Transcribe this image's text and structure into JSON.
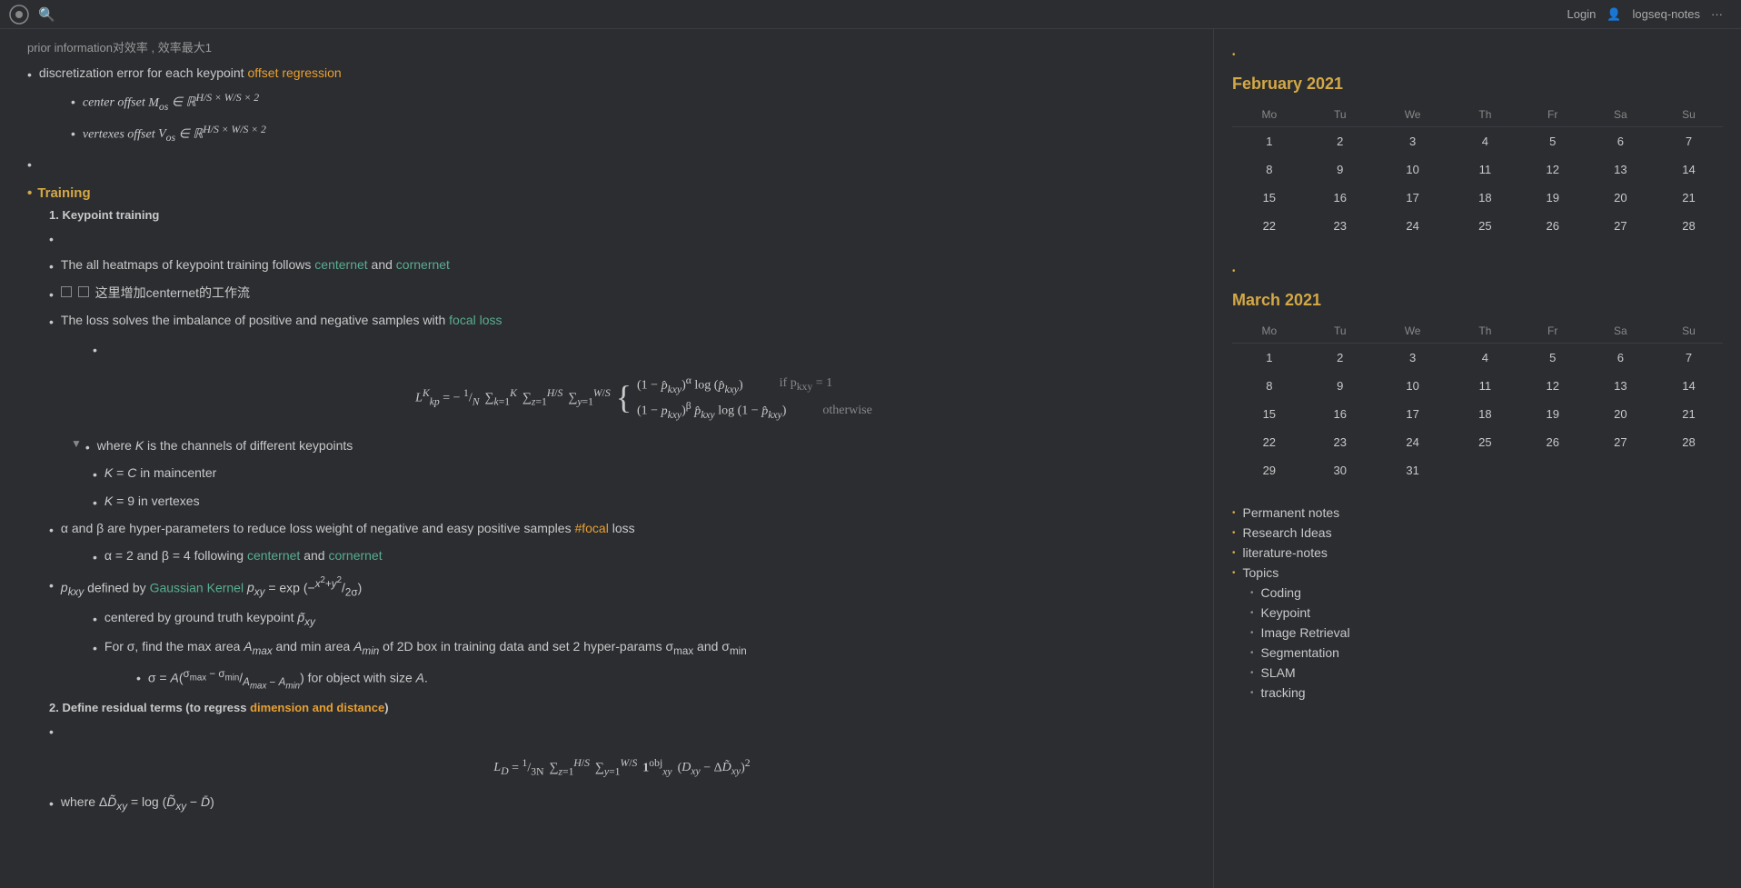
{
  "topbar": {
    "login_label": "Login",
    "notes_label": "logseq-notes",
    "more_label": "···"
  },
  "main_content": {
    "prior_info_text": "prior information对效率 ,效率最大1",
    "discretization_text": "discretization error for each keypoint",
    "offset_regression_label": "offset regression",
    "center_offset_text": "center offset",
    "vertexes_offset_text": "vertexes offset",
    "training_label": "Training",
    "keypoint_training_label": "1. Keypoint training",
    "heatmaps_text": "The all heatmaps of keypoint training follows",
    "centernet_label": "centernet",
    "and_text": "and",
    "cornernet_label": "cornernet",
    "chinese_note_text": "这里增加centernet的工作流",
    "loss_text": "The loss solves the imbalance of positive and negative samples with",
    "focal_loss_label": "focal loss",
    "where_K_text": "where K is the channels of different keypoints",
    "K_equals_C_text": "K = C in maincenter",
    "K_equals_9_text": "K = 9 in vertexes",
    "alpha_beta_text": "α and β are hyper-parameters to reduce loss weight of negative and easy positive samples #focal loss",
    "alpha_beta_values_text": "α = 2 and β = 4 following centernet and cornernet",
    "pkxy_text": "p_kxy defined by Gaussian Kernel",
    "centered_text": "centered by ground truth keypoint p̃_xy",
    "sigma_text": "For σ, find the max area A_max and min area A_min of 2D box in training data and set 2 hyper-params σ_max and σ_min",
    "sigma_formula_text": "σ = A((σ_max - σ_min)/(A_max - A_min)) for object with size A.",
    "define_residual_label": "2. Define residual terms (to regress",
    "dimension_distance_label": "dimension and distance",
    "define_residual_end": ")",
    "where_delta_text": "where Δ D̃_xy = log (D̃_xy - D̄)",
    "formula_lkp_parts": {
      "main": "L^K_kp = -1/N Σ Σ Σ {",
      "case1_expr": "(1 - p̂_kxy)^α log(p̂_kxy)",
      "case1_cond": "if p_kxy = 1",
      "case2_expr": "(1 - p_kxy)^β p̂_kxy log(1 - p̂_kxy)",
      "case2_cond": "otherwise"
    }
  },
  "right_panel": {
    "feb_2021": {
      "title": "February 2021",
      "days_header": [
        "Mo",
        "Tu",
        "We",
        "Th",
        "Fr",
        "Sa",
        "Su"
      ],
      "weeks": [
        [
          "1",
          "2",
          "3",
          "4",
          "5",
          "6",
          "7"
        ],
        [
          "8",
          "9",
          "10",
          "11",
          "12",
          "13",
          "14"
        ],
        [
          "15",
          "16",
          "17",
          "18",
          "19",
          "20",
          "21"
        ],
        [
          "22",
          "23",
          "24",
          "25",
          "26",
          "27",
          "28"
        ]
      ]
    },
    "mar_2021": {
      "title": "March 2021",
      "days_header": [
        "Mo",
        "Tu",
        "We",
        "Th",
        "Fr",
        "Sa",
        "Su"
      ],
      "weeks": [
        [
          "1",
          "2",
          "3",
          "4",
          "5",
          "6",
          "7"
        ],
        [
          "8",
          "9",
          "10",
          "11",
          "12",
          "13",
          "14"
        ],
        [
          "15",
          "16",
          "17",
          "18",
          "19",
          "20",
          "21"
        ],
        [
          "22",
          "23",
          "24",
          "25",
          "26",
          "27",
          "28"
        ],
        [
          "29",
          "30",
          "31",
          "",
          "",
          "",
          ""
        ]
      ]
    },
    "links": [
      {
        "label": "Permanent notes",
        "sub": false
      },
      {
        "label": "Research Ideas",
        "sub": false
      },
      {
        "label": "literature-notes",
        "sub": false
      },
      {
        "label": "Topics",
        "sub": false,
        "children": [
          "Coding",
          "Keypoint",
          "Image Retrieval",
          "Segmentation",
          "SLAM",
          "tracking"
        ]
      }
    ]
  }
}
